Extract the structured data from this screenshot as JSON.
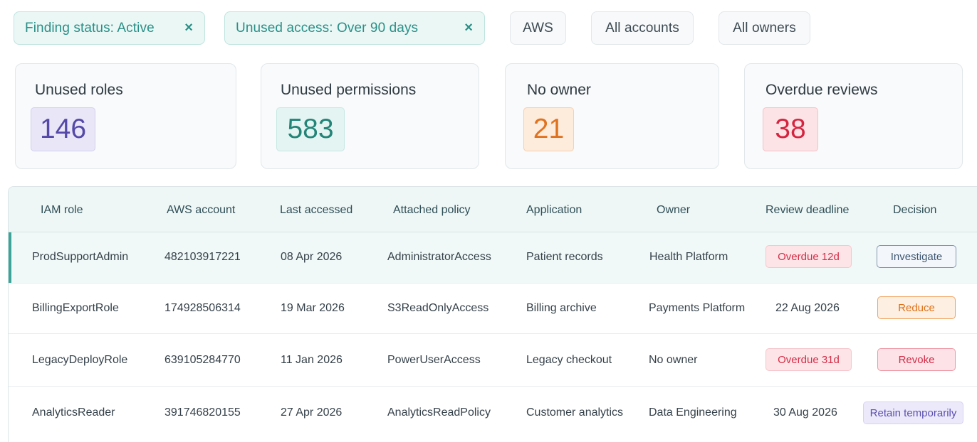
{
  "filters": {
    "finding_status": "Finding status: Active",
    "unused_access": "Unused access: Over 90 days",
    "remove_symbol": "×",
    "provider": "AWS",
    "accounts": "All accounts",
    "owners": "All owners"
  },
  "stats": [
    {
      "label": "Unused roles",
      "value": "146",
      "color": "#5448a8"
    },
    {
      "label": "Unused permissions",
      "value": "583",
      "color": "#238478"
    },
    {
      "label": "No owner",
      "value": "21",
      "color": "#e0731f"
    },
    {
      "label": "Overdue reviews",
      "value": "38",
      "color": "#d42540"
    }
  ],
  "table": {
    "columns": [
      "IAM role",
      "AWS account",
      "Last accessed",
      "Attached policy",
      "Application",
      "Owner",
      "Review deadline",
      "Decision"
    ],
    "rows": [
      {
        "role": "ProdSupportAdmin",
        "account": "482103917221",
        "last_accessed": "08 Apr 2026",
        "policy": "AdministratorAccess",
        "application": "Patient records",
        "owner": "Health Platform",
        "deadline": "Overdue 12d",
        "decision": "Investigate"
      },
      {
        "role": "BillingExportRole",
        "account": "174928506314",
        "last_accessed": "19 Mar 2026",
        "policy": "S3ReadOnlyAccess",
        "application": "Billing archive",
        "owner": "Payments Platform",
        "deadline": "22 Aug 2026",
        "decision": "Reduce"
      },
      {
        "role": "LegacyDeployRole",
        "account": "639105284770",
        "last_accessed": "11 Jan 2026",
        "policy": "PowerUserAccess",
        "application": "Legacy checkout",
        "owner": "No owner",
        "deadline": "Overdue 31d",
        "decision": "Revoke"
      },
      {
        "role": "AnalyticsReader",
        "account": "391746820155",
        "last_accessed": "27 Apr 2026",
        "policy": "AnalyticsReadPolicy",
        "application": "Customer analytics",
        "owner": "Data Engineering",
        "deadline": "30 Aug 2026",
        "decision": "Retain temporarily"
      }
    ]
  },
  "colors": {
    "accent": "#2a8f87",
    "overdue": "#d42e48",
    "investigate": "#3f5773",
    "reduce": "#df6f15",
    "revoke": "#d22c47",
    "retain": "#5b50b0"
  }
}
